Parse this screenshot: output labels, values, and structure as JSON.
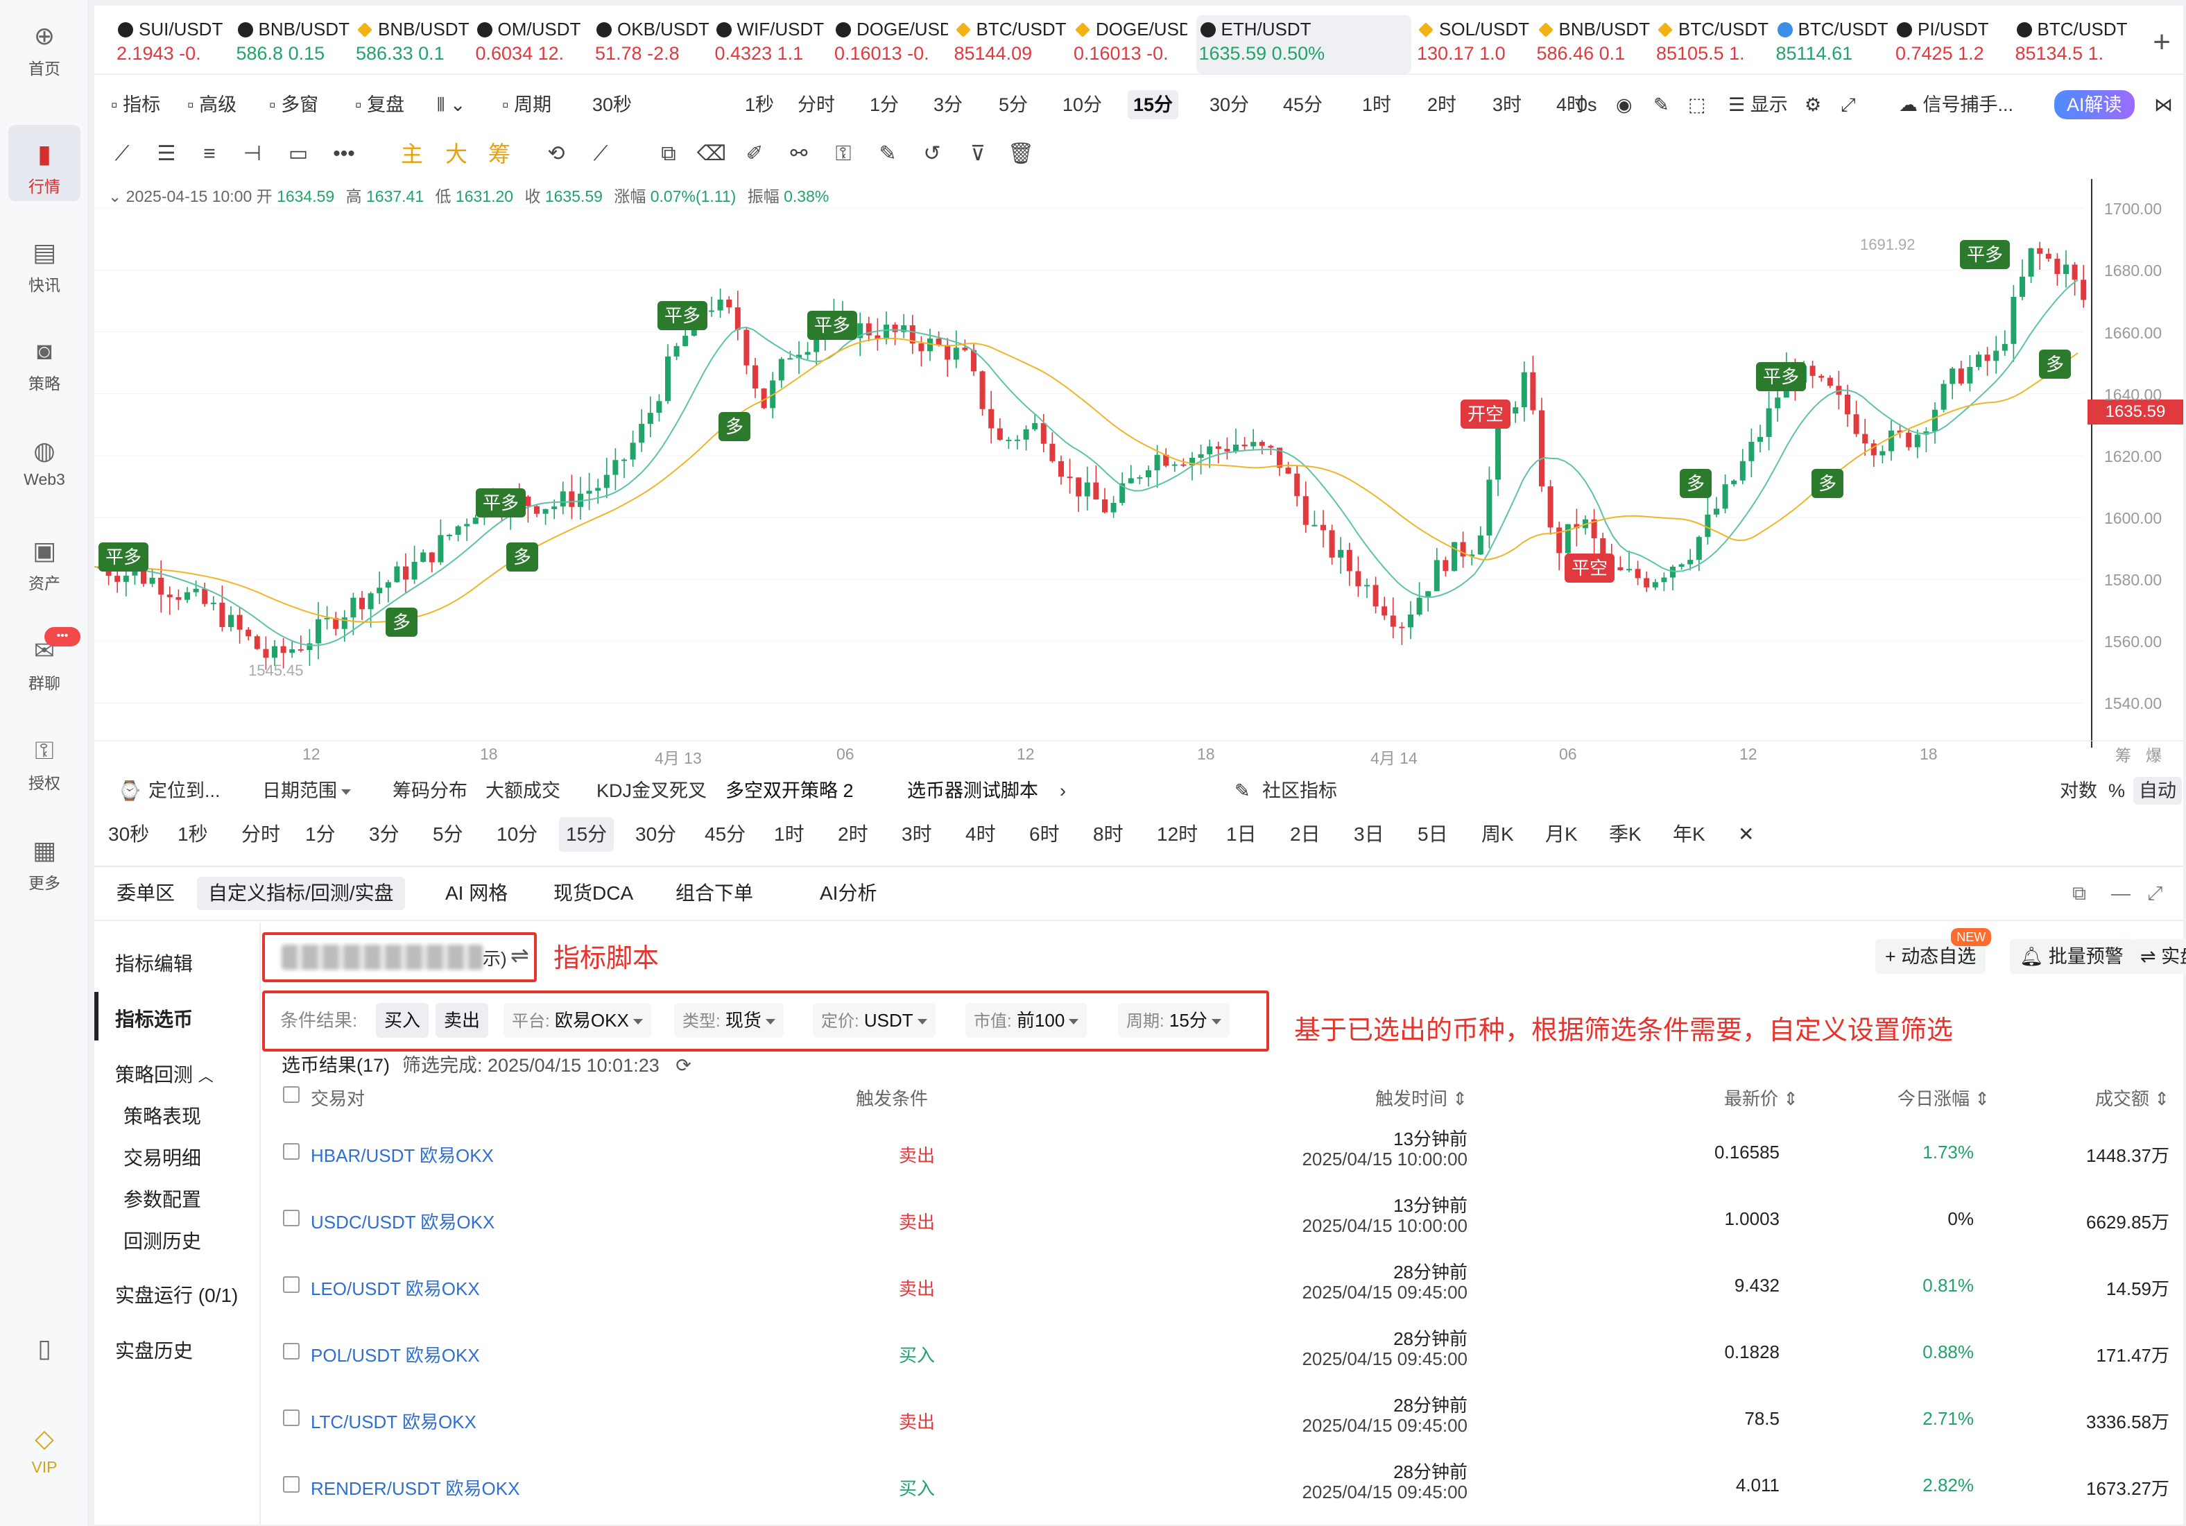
{
  "nav": [
    {
      "label": "首页",
      "icon": "home-icon",
      "glyph": "⊕"
    },
    {
      "label": "行情",
      "icon": "market-chart-icon",
      "glyph": "▮"
    },
    {
      "label": "快讯",
      "icon": "news-icon",
      "glyph": "▤"
    },
    {
      "label": "策略",
      "icon": "robot-strategy-icon",
      "glyph": "◙"
    },
    {
      "label": "Web3",
      "icon": "web3-icon",
      "glyph": "◍"
    },
    {
      "label": "资产",
      "icon": "wallet-icon",
      "glyph": "▣"
    },
    {
      "label": "群聊",
      "icon": "chat-icon",
      "glyph": "✉",
      "badge": "•••"
    },
    {
      "label": "授权",
      "icon": "authorize-icon",
      "glyph": "⚿"
    },
    {
      "label": "更多",
      "icon": "more-grid-icon",
      "glyph": "▦"
    },
    {
      "label": "",
      "icon": "mobile-icon",
      "glyph": "▯"
    },
    {
      "label": "VIP",
      "icon": "vip-diamond-icon",
      "glyph": "◇"
    }
  ],
  "tickers": [
    {
      "symbol": "SUI/USDT",
      "price": "2.1943",
      "change": "-0.",
      "dir": "dn",
      "style": ""
    },
    {
      "symbol": "BNB/USDT",
      "price": "586.8",
      "change": "0.15",
      "dir": "up",
      "style": ""
    },
    {
      "symbol": "BNB/USDT",
      "price": "586.33",
      "change": "0.1",
      "dir": "up",
      "style": "yel"
    },
    {
      "symbol": "OM/USDT",
      "price": "0.6034",
      "change": "12.",
      "dir": "dn",
      "style": ""
    },
    {
      "symbol": "OKB/USDT",
      "price": "51.78",
      "change": "-2.8",
      "dir": "dn",
      "style": ""
    },
    {
      "symbol": "WIF/USDT",
      "price": "0.4323",
      "change": "1.1",
      "dir": "dn",
      "style": ""
    },
    {
      "symbol": "DOGE/USDT",
      "price": "0.16013",
      "change": "-0.",
      "dir": "dn",
      "style": ""
    },
    {
      "symbol": "BTC/USDT",
      "price": "85144.09",
      "change": "",
      "dir": "dn",
      "style": "yel"
    },
    {
      "symbol": "DOGE/USDT",
      "price": "0.16013",
      "change": "-0.",
      "dir": "dn",
      "style": "yel"
    },
    {
      "symbol": "ETH/USDT",
      "price": "1635.59",
      "change": "0.50%",
      "dir": "up",
      "style": "",
      "selected": true
    },
    {
      "symbol": "SOL/USDT",
      "price": "130.17",
      "change": "1.0",
      "dir": "dn",
      "style": "yel"
    },
    {
      "symbol": "BNB/USDT",
      "price": "586.46",
      "change": "0.1",
      "dir": "dn",
      "style": "yel"
    },
    {
      "symbol": "BTC/USDT",
      "price": "85105.5",
      "change": "1.",
      "dir": "dn",
      "style": "yel"
    },
    {
      "symbol": "BTC/USDT",
      "price": "85114.61",
      "change": "",
      "dir": "up",
      "style": "blu"
    },
    {
      "symbol": "PI/USDT",
      "price": "0.7425",
      "change": "1.2",
      "dir": "dn",
      "style": ""
    },
    {
      "symbol": "BTC/USDT",
      "price": "85134.5",
      "change": "1.",
      "dir": "dn",
      "style": ""
    }
  ],
  "toolbar1": {
    "left": [
      "指标",
      "高级",
      "多窗",
      "复盘",
      "",
      "周期"
    ],
    "periods": [
      "30秒",
      "1秒",
      "分时",
      "1分",
      "3分",
      "5分",
      "10分",
      "15分",
      "30分",
      "45分",
      "1时",
      "2时",
      "3时",
      "4时"
    ],
    "selected_period": "15分",
    "right": {
      "countdown": "0s",
      "display": "显示",
      "signal": "信号捕手...",
      "ai": "AI解读"
    }
  },
  "chart": {
    "ohlc": {
      "date": "2025-04-15 10:00",
      "open_l": "开",
      "open": "1634.59",
      "high_l": "高",
      "high": "1637.41",
      "low_l": "低",
      "low": "1631.20",
      "close_l": "收",
      "close": "1635.59",
      "chg_l": "涨幅",
      "chg": "0.07%(1.11)",
      "amp_l": "振幅",
      "amp": "0.38%"
    },
    "y_ticks": [
      "1700.00",
      "1680.00",
      "1660.00",
      "1640.00",
      "1620.00",
      "1600.00",
      "1580.00",
      "1560.00",
      "1540.00"
    ],
    "y_range": [
      1530,
      1705
    ],
    "last_price": "1635.59",
    "high_label": "1691.92",
    "low_label": "1545.45",
    "x_ticks": [
      "12",
      "18",
      "4月 13",
      "06",
      "12",
      "18",
      "4月 14",
      "06",
      "12",
      "18"
    ],
    "corner_labels": [
      "筹",
      "爆"
    ],
    "markers": [
      {
        "text": "平多",
        "color": "g"
      },
      {
        "text": "多",
        "color": "g"
      },
      {
        "text": "平多",
        "color": "g"
      },
      {
        "text": "多",
        "color": "g"
      },
      {
        "text": "平多",
        "color": "g"
      },
      {
        "text": "多",
        "color": "g"
      },
      {
        "text": "平多",
        "color": "g"
      },
      {
        "text": "开空",
        "color": "r"
      },
      {
        "text": "平空",
        "color": "r"
      },
      {
        "text": "多",
        "color": "g"
      },
      {
        "text": "平多",
        "color": "g"
      },
      {
        "text": "多",
        "color": "g"
      },
      {
        "text": "平多",
        "color": "g"
      },
      {
        "text": "多",
        "color": "g"
      }
    ]
  },
  "sub_bar1": {
    "locate": "定位到...",
    "date_range": "日期范围",
    "items": [
      "筹码分布",
      "大额成交",
      "KDJ金叉死叉",
      "多空双开策略 2",
      "选币器测试脚本"
    ],
    "community": "社区指标",
    "log": "对数",
    "pct": "%",
    "auto": "自动"
  },
  "periods2": [
    "30秒",
    "1秒",
    "分时",
    "1分",
    "3分",
    "5分",
    "10分",
    "15分",
    "30分",
    "45分",
    "1时",
    "2时",
    "3时",
    "4时",
    "6时",
    "8时",
    "12时",
    "1日",
    "2日",
    "3日",
    "5日",
    "周K",
    "月K",
    "季K",
    "年K"
  ],
  "selected_period2": "15分",
  "bottom_tabs": [
    "委单区",
    "自定义指标/回测/实盘",
    "AI 网格",
    "现货DCA",
    "组合下单",
    "AI分析"
  ],
  "side_menu": {
    "edit": "指标编辑",
    "select": "指标选币",
    "backtest": "策略回测",
    "perf": "策略表现",
    "trades": "交易明细",
    "params": "参数配置",
    "history": "回测历史",
    "live": "实盘运行 (0/1)",
    "live_history": "实盘历史"
  },
  "annotations": {
    "script": "指标脚本",
    "filter": "基于已选出的币种，根据筛选条件需要，自定义设置筛选"
  },
  "right_buttons": {
    "watch": "动态自选",
    "new": "NEW",
    "alert": "批量预警",
    "run": "实盘运行"
  },
  "script_suffix": "示)",
  "filters": {
    "label": "条件结果:",
    "buy": "买入",
    "sell": "卖出",
    "platform_k": "平台:",
    "platform_v": "欧易OKX",
    "type_k": "类型:",
    "type_v": "现货",
    "quote_k": "定价:",
    "quote_v": "USDT",
    "cap_k": "市值:",
    "cap_v": "前100",
    "period_k": "周期:",
    "period_v": "15分"
  },
  "result": {
    "title": "选币结果(17)",
    "time": "筛选完成: 2025/04/15 10:01:23"
  },
  "table": {
    "headers": [
      "交易对",
      "触发条件",
      "触发时间",
      "最新价",
      "今日涨幅",
      "成交额"
    ],
    "rows": [
      {
        "pair": "HBAR/USDT 欧易OKX",
        "cond": "卖出",
        "ago": "13分钟前",
        "time": "2025/04/15 10:00:00",
        "price": "0.16585",
        "chg": "1.73%",
        "vol": "1448.37万"
      },
      {
        "pair": "USDC/USDT 欧易OKX",
        "cond": "卖出",
        "ago": "13分钟前",
        "time": "2025/04/15 10:00:00",
        "price": "1.0003",
        "chg": "0%",
        "vol": "6629.85万"
      },
      {
        "pair": "LEO/USDT 欧易OKX",
        "cond": "卖出",
        "ago": "28分钟前",
        "time": "2025/04/15 09:45:00",
        "price": "9.432",
        "chg": "0.81%",
        "vol": "14.59万"
      },
      {
        "pair": "POL/USDT 欧易OKX",
        "cond": "买入",
        "ago": "28分钟前",
        "time": "2025/04/15 09:45:00",
        "price": "0.1828",
        "chg": "0.88%",
        "vol": "171.47万"
      },
      {
        "pair": "LTC/USDT 欧易OKX",
        "cond": "卖出",
        "ago": "28分钟前",
        "time": "2025/04/15 09:45:00",
        "price": "78.5",
        "chg": "2.71%",
        "vol": "3336.58万"
      },
      {
        "pair": "RENDER/USDT 欧易OKX",
        "cond": "买入",
        "ago": "28分钟前",
        "time": "2025/04/15 09:45:00",
        "price": "4.011",
        "chg": "2.82%",
        "vol": "1673.27万"
      }
    ]
  },
  "colors": {
    "up": "#20a46a",
    "down": "#e0393e",
    "ma_fast": "#5cc3a8",
    "ma_slow": "#f0b429"
  }
}
